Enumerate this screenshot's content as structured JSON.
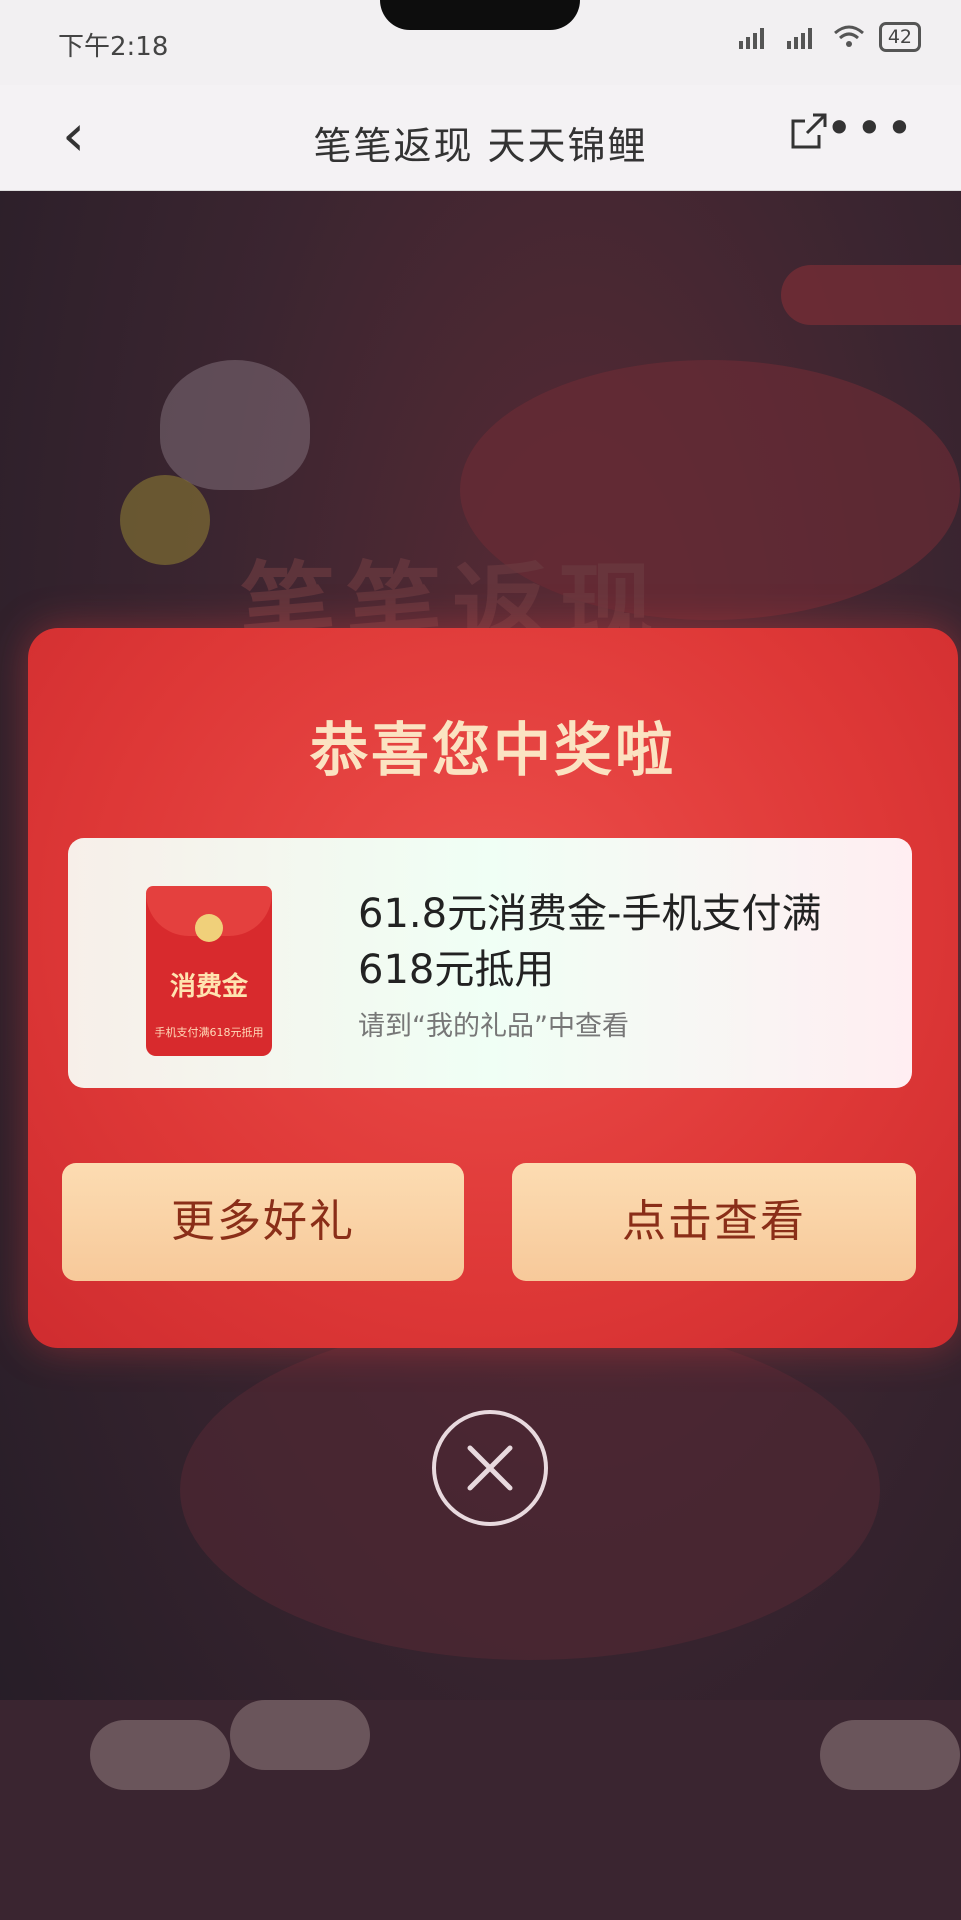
{
  "status_bar": {
    "time": "下午2:18",
    "battery": "42"
  },
  "navbar": {
    "title": "笔笔返现 天天锦鲤",
    "more": "•••"
  },
  "background": {
    "heading": "笔笔返现"
  },
  "modal": {
    "title": "恭喜您中奖啦",
    "prize": {
      "packet_label": "消费金",
      "packet_subtext": "手机支付满618元抵用",
      "name": "61.8元消费金-手机支付满618元抵用",
      "hint": "请到“我的礼品”中查看"
    },
    "buttons": {
      "more_gifts": "更多好礼",
      "view": "点击查看"
    }
  }
}
